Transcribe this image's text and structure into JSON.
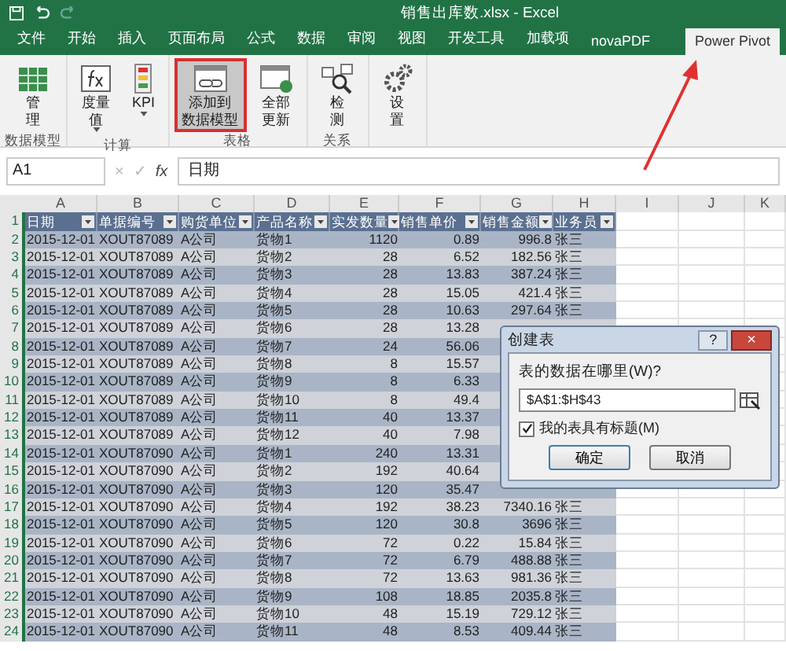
{
  "window": {
    "title": "销售出库数.xlsx - Excel"
  },
  "tabs": [
    {
      "label": "文件",
      "selected": false
    },
    {
      "label": "开始",
      "selected": false
    },
    {
      "label": "插入",
      "selected": false
    },
    {
      "label": "页面布局",
      "selected": false
    },
    {
      "label": "公式",
      "selected": false
    },
    {
      "label": "数据",
      "selected": false
    },
    {
      "label": "审阅",
      "selected": false
    },
    {
      "label": "视图",
      "selected": false
    },
    {
      "label": "开发工具",
      "selected": false
    },
    {
      "label": "加载项",
      "selected": false
    },
    {
      "label": "novaPDF",
      "selected": false
    },
    {
      "label": "Power Pivot",
      "selected": true
    }
  ],
  "ribbon_groups": [
    {
      "label": "数据模型",
      "buttons": [
        {
          "kind": "manage",
          "lines": [
            "管",
            "理"
          ],
          "dropdown": false,
          "highlighted": false,
          "annotated": false
        }
      ]
    },
    {
      "label": "计算",
      "buttons": [
        {
          "kind": "measure",
          "lines": [
            "度量",
            "值"
          ],
          "dropdown": true,
          "highlighted": false,
          "annotated": false
        },
        {
          "kind": "kpi",
          "lines": [
            "KPI"
          ],
          "dropdown": true,
          "highlighted": false,
          "annotated": false
        }
      ]
    },
    {
      "label": "表格",
      "buttons": [
        {
          "kind": "add",
          "lines": [
            "添加到",
            "数据模型"
          ],
          "dropdown": false,
          "highlighted": true,
          "annotated": true
        },
        {
          "kind": "refresh",
          "lines": [
            "全部",
            "更新"
          ],
          "dropdown": false,
          "highlighted": false,
          "annotated": false
        }
      ]
    },
    {
      "label": "关系",
      "buttons": [
        {
          "kind": "detect",
          "lines": [
            "检",
            "测"
          ],
          "dropdown": false,
          "highlighted": false,
          "annotated": false
        }
      ]
    },
    {
      "buttons": [
        {
          "kind": "settings",
          "lines": [
            "设",
            "置"
          ],
          "dropdown": false,
          "highlighted": false,
          "annotated": false
        }
      ]
    }
  ],
  "formula_bar": {
    "name_box": "A1",
    "cancel": "×",
    "enter": "✓",
    "fx": "fx",
    "value": "日期"
  },
  "columns": [
    "A",
    "B",
    "C",
    "D",
    "E",
    "F",
    "G",
    "H",
    "I",
    "J",
    "K"
  ],
  "header_row": {
    "num": "1",
    "cells": [
      "日期",
      "单据编号",
      "购货单位",
      "产品名称",
      "实发数量",
      "销售单价",
      "销售金额",
      "业务员"
    ]
  },
  "rows": [
    {
      "num": "2",
      "cells": [
        "2015-12-01",
        "XOUT87089",
        "A公司",
        "货物1",
        "1120",
        "0.89",
        "996.8",
        "张三"
      ]
    },
    {
      "num": "3",
      "cells": [
        "2015-12-01",
        "XOUT87089",
        "A公司",
        "货物2",
        "28",
        "6.52",
        "182.56",
        "张三"
      ]
    },
    {
      "num": "4",
      "cells": [
        "2015-12-01",
        "XOUT87089",
        "A公司",
        "货物3",
        "28",
        "13.83",
        "387.24",
        "张三"
      ]
    },
    {
      "num": "5",
      "cells": [
        "2015-12-01",
        "XOUT87089",
        "A公司",
        "货物4",
        "28",
        "15.05",
        "421.4",
        "张三"
      ]
    },
    {
      "num": "6",
      "cells": [
        "2015-12-01",
        "XOUT87089",
        "A公司",
        "货物5",
        "28",
        "10.63",
        "297.64",
        "张三"
      ]
    },
    {
      "num": "7",
      "cells": [
        "2015-12-01",
        "XOUT87089",
        "A公司",
        "货物6",
        "28",
        "13.28"
      ]
    },
    {
      "num": "8",
      "cells": [
        "2015-12-01",
        "XOUT87089",
        "A公司",
        "货物7",
        "24",
        "56.06"
      ]
    },
    {
      "num": "9",
      "cells": [
        "2015-12-01",
        "XOUT87089",
        "A公司",
        "货物8",
        "8",
        "15.57"
      ]
    },
    {
      "num": "10",
      "cells": [
        "2015-12-01",
        "XOUT87089",
        "A公司",
        "货物9",
        "8",
        "6.33"
      ]
    },
    {
      "num": "11",
      "cells": [
        "2015-12-01",
        "XOUT87089",
        "A公司",
        "货物10",
        "8",
        "49.4"
      ]
    },
    {
      "num": "12",
      "cells": [
        "2015-12-01",
        "XOUT87089",
        "A公司",
        "货物11",
        "40",
        "13.37"
      ]
    },
    {
      "num": "13",
      "cells": [
        "2015-12-01",
        "XOUT87089",
        "A公司",
        "货物12",
        "40",
        "7.98"
      ]
    },
    {
      "num": "14",
      "cells": [
        "2015-12-01",
        "XOUT87090",
        "A公司",
        "货物1",
        "240",
        "13.31"
      ]
    },
    {
      "num": "15",
      "cells": [
        "2015-12-01",
        "XOUT87090",
        "A公司",
        "货物2",
        "192",
        "40.64"
      ]
    },
    {
      "num": "16",
      "cells": [
        "2015-12-01",
        "XOUT87090",
        "A公司",
        "货物3",
        "120",
        "35.47"
      ]
    },
    {
      "num": "17",
      "cells": [
        "2015-12-01",
        "XOUT87090",
        "A公司",
        "货物4",
        "192",
        "38.23",
        "7340.16",
        "张三"
      ]
    },
    {
      "num": "18",
      "cells": [
        "2015-12-01",
        "XOUT87090",
        "A公司",
        "货物5",
        "120",
        "30.8",
        "3696",
        "张三"
      ]
    },
    {
      "num": "19",
      "cells": [
        "2015-12-01",
        "XOUT87090",
        "A公司",
        "货物6",
        "72",
        "0.22",
        "15.84",
        "张三"
      ]
    },
    {
      "num": "20",
      "cells": [
        "2015-12-01",
        "XOUT87090",
        "A公司",
        "货物7",
        "72",
        "6.79",
        "488.88",
        "张三"
      ]
    },
    {
      "num": "21",
      "cells": [
        "2015-12-01",
        "XOUT87090",
        "A公司",
        "货物8",
        "72",
        "13.63",
        "981.36",
        "张三"
      ]
    },
    {
      "num": "22",
      "cells": [
        "2015-12-01",
        "XOUT87090",
        "A公司",
        "货物9",
        "108",
        "18.85",
        "2035.8",
        "张三"
      ]
    },
    {
      "num": "23",
      "cells": [
        "2015-12-01",
        "XOUT87090",
        "A公司",
        "货物10",
        "48",
        "15.19",
        "729.12",
        "张三"
      ]
    },
    {
      "num": "24",
      "cells": [
        "2015-12-01",
        "XOUT87090",
        "A公司",
        "货物11",
        "48",
        "8.53",
        "409.44",
        "张三"
      ]
    }
  ],
  "dialog": {
    "title": "创建表",
    "help": "?",
    "close": "×",
    "prompt": "表的数据在哪里(W)?",
    "range": "$A$1:$H$43",
    "has_headers": {
      "label": "我的表具有标题(M)",
      "checked": true
    },
    "buttons": [
      "确定",
      "取消"
    ]
  }
}
